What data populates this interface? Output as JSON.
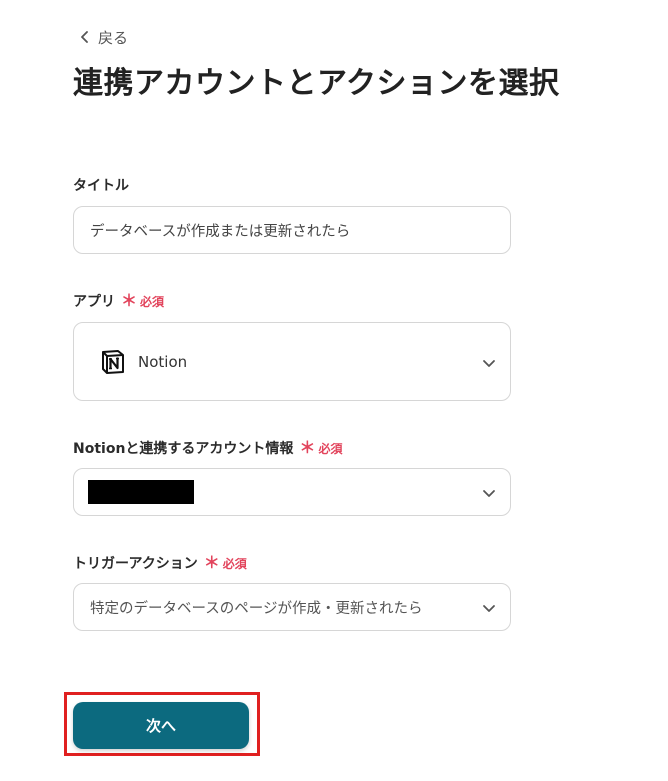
{
  "back": {
    "label": "戻る",
    "icon": "chevron-left-icon"
  },
  "page_title": "連携アカウントとアクションを選択",
  "required_label": "必須",
  "required_mark": "＊",
  "colors": {
    "accent": "#0c6a7f",
    "required": "#e2445c",
    "highlight": "#e02020",
    "border": "#d6d6d6"
  },
  "title_field": {
    "label": "タイトル",
    "value": "データベースが作成または更新されたら",
    "placeholder": ""
  },
  "app_field": {
    "label": "アプリ",
    "selected": "Notion",
    "icon": "notion-logo-icon"
  },
  "account_field": {
    "label": "Notionと連携するアカウント情報"
  },
  "trigger_field": {
    "label": "トリガーアクション",
    "selected": "特定のデータベースのページが作成・更新されたら"
  },
  "next_button": {
    "label": "次へ"
  }
}
